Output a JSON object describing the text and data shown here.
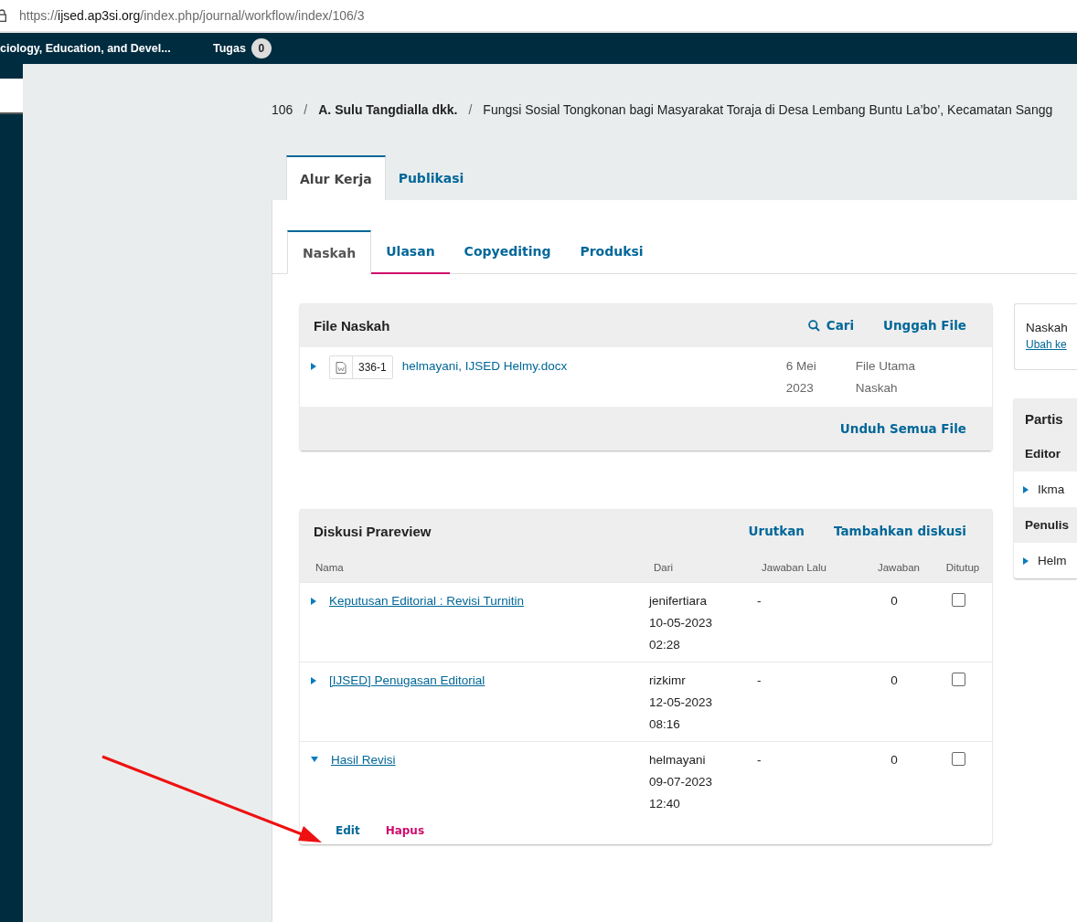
{
  "browser": {
    "url_prefix": "https://",
    "url_host": "ijsed.ap3si.org",
    "url_path": "/index.php/journal/workflow/index/106/3"
  },
  "header": {
    "journal_title": "ciology, Education, and Devel...",
    "tasks_label": "Tugas",
    "tasks_count": "0"
  },
  "breadcrumb": {
    "id": "106",
    "separator": "/",
    "authors": "A. Sulu Tangdialla dkk.",
    "title": "Fungsi Sosial Tongkonan bagi Masyarakat Toraja di Desa Lembang Buntu La’bo’, Kecamatan Sangg"
  },
  "tabs": [
    {
      "label": "Alur Kerja",
      "selected": true
    },
    {
      "label": "Publikasi",
      "selected": false
    }
  ],
  "stage_tabs": [
    {
      "label": "Naskah",
      "selected": true,
      "underlined": false
    },
    {
      "label": "Ulasan",
      "selected": false,
      "underlined": true
    },
    {
      "label": "Copyediting",
      "selected": false,
      "underlined": false
    },
    {
      "label": "Produksi",
      "selected": false,
      "underlined": false
    }
  ],
  "files": {
    "title": "File Naskah",
    "actions": [
      "Cari",
      "Unggah File"
    ],
    "rows": [
      {
        "id": "336-1",
        "name": "helmayani, IJSED Helmy.docx",
        "date": [
          "6 Mei",
          "2023"
        ],
        "type": [
          "File Utama",
          "Naskah"
        ],
        "expanded": false
      }
    ],
    "footer_action": "Unduh Semua File"
  },
  "discussions": {
    "title": "Diskusi Prareview",
    "actions": [
      "Urutkan",
      "Tambahkan diskusi"
    ],
    "columns": [
      "Nama",
      "Dari",
      "Jawaban Lalu",
      "Jawaban",
      "Ditutup"
    ],
    "rows": [
      {
        "name": "Keputusan Editorial : Revisi Turnitin",
        "from": [
          "jenifertiara",
          "10-05-2023",
          "02:28"
        ],
        "last_reply": "-",
        "replies": "0",
        "closed": false,
        "expanded": false
      },
      {
        "name": "[IJSED] Penugasan Editorial",
        "from": [
          "rizkimr",
          "12-05-2023",
          "08:16"
        ],
        "last_reply": "-",
        "replies": "0",
        "closed": false,
        "expanded": false
      },
      {
        "name": "Hasil Revisi",
        "from": [
          "helmayani",
          "09-07-2023",
          "12:40"
        ],
        "last_reply": "-",
        "replies": "0",
        "closed": false,
        "expanded": true,
        "row_actions": [
          {
            "label": "Edit",
            "kind": "primary"
          },
          {
            "label": "Hapus",
            "kind": "danger"
          }
        ]
      }
    ]
  },
  "side": {
    "status_text": "Naskah",
    "status_link": "Ubah ke",
    "participants_title": "Partis",
    "groups": [
      {
        "label": "Editor",
        "members": [
          "Ikma"
        ]
      },
      {
        "label": "Penulis",
        "members": [
          "Helm"
        ]
      }
    ]
  },
  "annotation": {
    "kind": "arrow",
    "color": "#ee1111"
  }
}
